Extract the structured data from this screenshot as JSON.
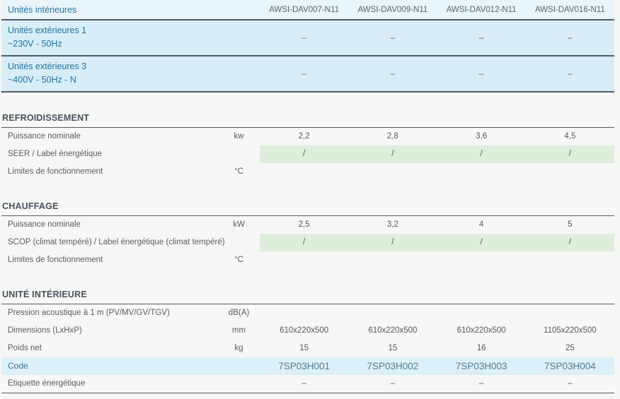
{
  "header": {
    "label": "Unités intérieures",
    "columns": [
      "AWSI-DAV007-N11",
      "AWSI-DAV009-N11",
      "AWSI-DAV012-N11",
      "AWSI-DAV016-N11"
    ]
  },
  "outdoor": [
    {
      "name": "Unités extérieures 1",
      "spec": "~230V - 50Hz",
      "values": [
        "–",
        "–",
        "–",
        "–"
      ]
    },
    {
      "name": "Unités extérieures 3",
      "spec": "~400V - 50Hz - N",
      "values": [
        "–",
        "–",
        "–",
        "–"
      ]
    }
  ],
  "sections": [
    {
      "title": "REFROIDISSEMENT",
      "rows": [
        {
          "label": "Puissance nominale",
          "unit": "kw",
          "values": [
            "2,2",
            "2,8",
            "3,6",
            "4,5"
          ]
        },
        {
          "label": "SEER / Label énergétique",
          "unit": "",
          "values": [
            "/",
            "/",
            "/",
            "/"
          ]
        },
        {
          "label": "Limites de fonctionnement",
          "unit": "°C",
          "values": [
            "",
            "",
            "",
            ""
          ]
        }
      ]
    },
    {
      "title": "CHAUFFAGE",
      "rows": [
        {
          "label": "Puissance nominale",
          "unit": "kW",
          "values": [
            "2,5",
            "3,2",
            "4",
            "5"
          ]
        },
        {
          "label": "SCOP (climat tempéré) / Label énergétique (climat tempéré)",
          "unit": "",
          "values": [
            "/",
            "/",
            "/",
            "/"
          ]
        },
        {
          "label": "Limites de fonctionnement",
          "unit": "°C",
          "values": [
            "",
            "",
            "",
            ""
          ]
        }
      ]
    },
    {
      "title": "UNITÉ INTÉRIEURE",
      "rows": [
        {
          "label": "Pression acoustique à 1 m (PV/MV/GV/TGV)",
          "unit": "dB(A)",
          "values": [
            "",
            "",
            "",
            ""
          ]
        },
        {
          "label": "Dimensions (LxHxP)",
          "unit": "mm",
          "values": [
            "610x220x500",
            "610x220x500",
            "610x220x500",
            "1105x220x500"
          ]
        },
        {
          "label": "Poids net",
          "unit": "kg",
          "values": [
            "15",
            "15",
            "16",
            "25"
          ]
        },
        {
          "label": "Code",
          "unit": "",
          "values": [
            "7SP03H001",
            "7SP03H002",
            "7SP03H003",
            "7SP03H004"
          ]
        },
        {
          "label": "Etiquette énergétique",
          "unit": "",
          "values": [
            "–",
            "–",
            "–",
            "–"
          ]
        }
      ]
    }
  ],
  "colors": {
    "accent_blue_text": "#2173a6",
    "header_row_bg": "#e9f4fb",
    "outdoor_row_bg": "#d9edf8",
    "green_highlight_bg": "#ddeedb",
    "code_row_bg": "#dcf0f9",
    "dark_border": "#4f5d68"
  }
}
